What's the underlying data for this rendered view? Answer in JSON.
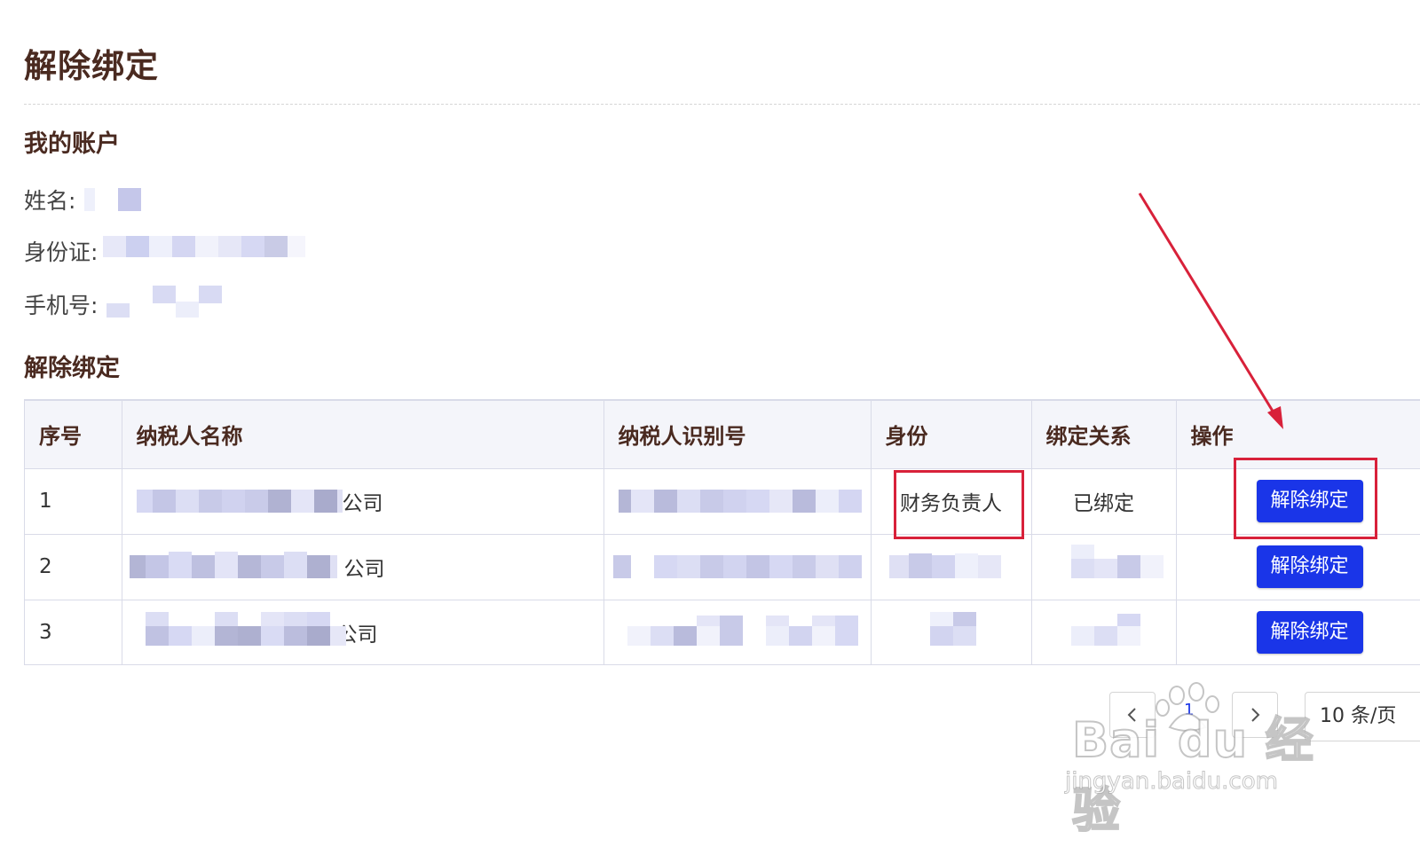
{
  "page": {
    "title": "解除绑定"
  },
  "account": {
    "section_title": "我的账户",
    "name_label": "姓名:",
    "id_label": "身份证:",
    "phone_label": "手机号:"
  },
  "binding": {
    "section_title": "解除绑定",
    "columns": [
      "序号",
      "纳税人名称",
      "纳税人识别号",
      "身份",
      "绑定关系",
      "操作"
    ],
    "rows": [
      {
        "index": "1",
        "name_suffix": "公司",
        "identity": "财务负责人",
        "relation": "已绑定",
        "action": "解除绑定"
      },
      {
        "index": "2",
        "name_suffix": "公司",
        "identity": "",
        "relation": "",
        "action": "解除绑定"
      },
      {
        "index": "3",
        "name_suffix": "公司",
        "identity": "",
        "relation": "",
        "action": "解除绑定"
      }
    ]
  },
  "pagination": {
    "prev_icon": "chevron-left-icon",
    "next_icon": "chevron-right-icon",
    "current_page": "1",
    "page_size": "10 条/页"
  },
  "watermark": {
    "main": "Bai du 经验",
    "sub": "jingyan.baidu.com"
  },
  "colors": {
    "primary_button": "#1a35e8",
    "heading": "#4a2a20",
    "annotation": "#d8213a"
  }
}
